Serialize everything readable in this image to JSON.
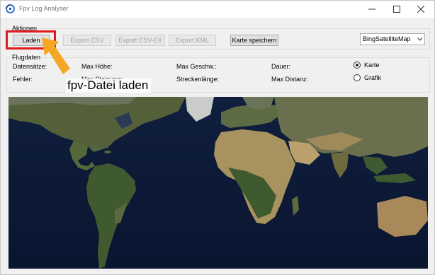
{
  "window": {
    "title": "Fpv Log Analyser"
  },
  "actions": {
    "group_label": "Aktionen",
    "laden_label": "Laden",
    "export_csv_label": "Export CSV",
    "export_csv_ex_label": "Export CSV-EX",
    "export_kml_label": "Export KML",
    "save_map_label": "Karte speichern",
    "map_provider": {
      "selected": "BingSatelliteMap"
    }
  },
  "flight": {
    "group_label": "Flugdaten",
    "datensaetze": "Datensätze:",
    "fehler": "Fehler:",
    "max_hoehe": "Max Höhe:",
    "max_steigung": "Max Steigung:",
    "max_geschw": "Max Geschw.:",
    "streckenlaenge": "Streckenlänge:",
    "dauer": "Dauer:",
    "max_distanz": "Max Distanz:",
    "view_karte": "Karte",
    "view_grafik": "Grafik",
    "view_selected": "Karte"
  },
  "annotation": {
    "text": "fpv-Datei laden",
    "highlight_color": "#e0191a",
    "arrow_color": "#f5a623"
  },
  "colors": {
    "window_bg": "#f0f0f0",
    "ocean": "#0d1a33",
    "land": "#5c6a3a",
    "desert": "#b49a68"
  }
}
